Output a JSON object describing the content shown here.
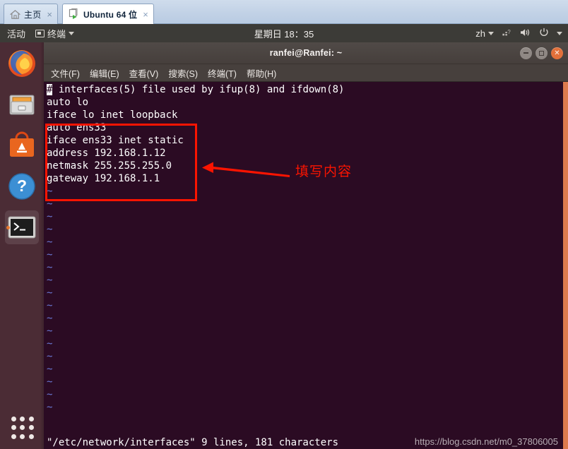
{
  "vmware": {
    "tabs": [
      {
        "label": "主页",
        "icon": "home-icon",
        "active": false,
        "close": "×"
      },
      {
        "label": "Ubuntu 64 位",
        "icon": "virtual-machine-icon",
        "active": true,
        "close": "×"
      }
    ]
  },
  "ubuntu_topbar": {
    "activities": "活动",
    "app_menu": "终端",
    "app_menu_icon": "terminal-icon",
    "clock": "星期日 18：35",
    "keyboard_layout": "zh",
    "indicators": [
      "network-icon",
      "volume-icon",
      "power-icon"
    ]
  },
  "dock": {
    "items": [
      {
        "name": "firefox",
        "label": "Firefox",
        "running": false
      },
      {
        "name": "files",
        "label": "文件",
        "running": false
      },
      {
        "name": "ubuntu-software",
        "label": "Ubuntu 软件",
        "running": false
      },
      {
        "name": "help",
        "label": "帮助",
        "running": false
      },
      {
        "name": "terminal",
        "label": "终端",
        "running": true
      }
    ],
    "show_apps": "show-applications-grid-icon"
  },
  "terminal": {
    "title": "ranfei@Ranfei: ~",
    "menu": [
      "文件(F)",
      "编辑(E)",
      "查看(V)",
      "搜索(S)",
      "终端(T)",
      "帮助(H)"
    ],
    "window_buttons": [
      "minimize",
      "maximize",
      "close"
    ],
    "content_lines": [
      "# interfaces(5) file used by ifup(8) and ifdown(8)",
      "auto lo",
      "iface lo inet loopback",
      "auto ens33",
      "iface ens33 inet static",
      "address 192.168.1.12",
      "netmask 255.255.255.0",
      "gateway 192.168.1.1"
    ],
    "cursor_char": "#",
    "tilde": "~",
    "tilde_count": 18,
    "status_line": "\"/etc/network/interfaces\" 9 lines, 181 characters",
    "watermark": "https://blog.csdn.net/m0_37806005"
  },
  "annotation": {
    "label": "填写内容",
    "color": "#fb1400"
  },
  "colors": {
    "terminal_bg": "#2b0b23",
    "terminal_fg": "#ffffff",
    "tilde_blue": "#6a79d6",
    "dock_bg": "#4b2c35",
    "topbar_bg": "#3c3b37",
    "titlebar_bg": "#463f3c",
    "accent_orange": "#e2703a",
    "annotation_red": "#fb1400",
    "tabbar_bg": "#c2d2e6"
  }
}
